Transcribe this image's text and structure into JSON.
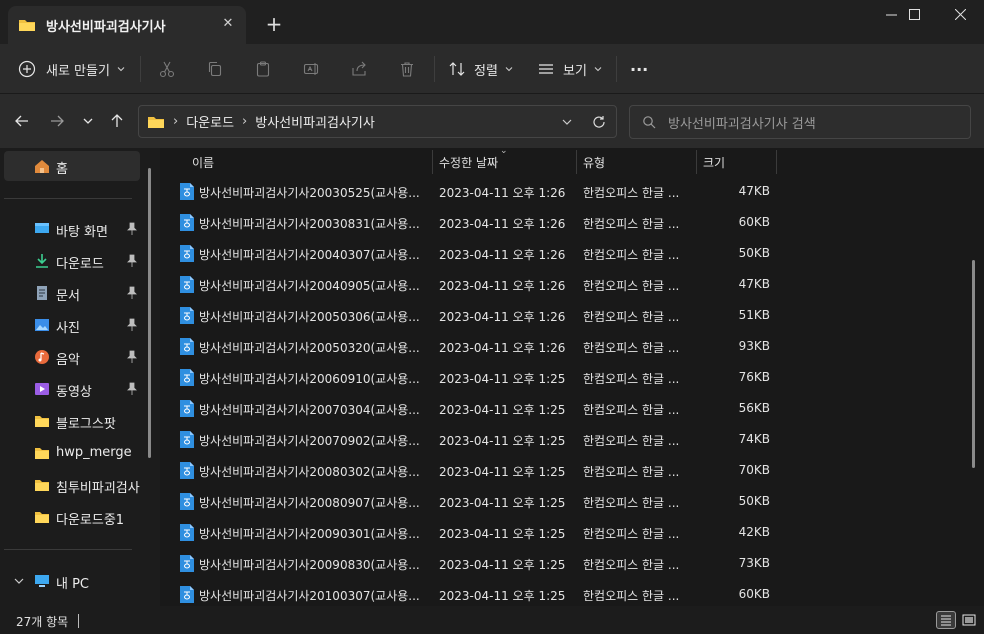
{
  "window": {
    "tab_title": "방사선비파괴검사기사",
    "new_tab_symbol": "+",
    "close_tab_symbol": "✕",
    "minimize_symbol": "—",
    "maximize_symbol": "☐",
    "close_symbol": "✕"
  },
  "toolbar": {
    "new_label": "새로 만들기",
    "sort_label": "정렬",
    "view_label": "보기",
    "more_symbol": "···"
  },
  "address": {
    "segments": [
      "다운로드",
      "방사선비파괴검사기사"
    ],
    "search_placeholder": "방사선비파괴검사기사 검색"
  },
  "sidebar": {
    "home": "홈",
    "quick_access": [
      {
        "label": "바탕 화면",
        "icon": "desktop-icon",
        "pinned": true
      },
      {
        "label": "다운로드",
        "icon": "download-icon",
        "pinned": true
      },
      {
        "label": "문서",
        "icon": "document-icon",
        "pinned": true
      },
      {
        "label": "사진",
        "icon": "picture-icon",
        "pinned": true
      },
      {
        "label": "음악",
        "icon": "music-icon",
        "pinned": true
      },
      {
        "label": "동영상",
        "icon": "video-icon",
        "pinned": true
      },
      {
        "label": "블로그스팟",
        "icon": "folder-icon",
        "pinned": false
      },
      {
        "label": "hwp_merge",
        "icon": "folder-icon",
        "pinned": false
      },
      {
        "label": "침투비파괴검사",
        "icon": "folder-icon",
        "pinned": false
      },
      {
        "label": "다운로드중1",
        "icon": "folder-icon",
        "pinned": false
      }
    ],
    "this_pc": "내 PC"
  },
  "columns": {
    "name": "이름",
    "date": "수정한 날짜",
    "type": "유형",
    "size": "크기"
  },
  "files": [
    {
      "name": "방사선비파괴검사기사20030525(교사용...",
      "date": "2023-04-11 오후 1:26",
      "type": "한컴오피스 한글 ...",
      "size": "47KB"
    },
    {
      "name": "방사선비파괴검사기사20030831(교사용...",
      "date": "2023-04-11 오후 1:26",
      "type": "한컴오피스 한글 ...",
      "size": "60KB"
    },
    {
      "name": "방사선비파괴검사기사20040307(교사용...",
      "date": "2023-04-11 오후 1:26",
      "type": "한컴오피스 한글 ...",
      "size": "50KB"
    },
    {
      "name": "방사선비파괴검사기사20040905(교사용...",
      "date": "2023-04-11 오후 1:26",
      "type": "한컴오피스 한글 ...",
      "size": "47KB"
    },
    {
      "name": "방사선비파괴검사기사20050306(교사용...",
      "date": "2023-04-11 오후 1:26",
      "type": "한컴오피스 한글 ...",
      "size": "51KB"
    },
    {
      "name": "방사선비파괴검사기사20050320(교사용...",
      "date": "2023-04-11 오후 1:26",
      "type": "한컴오피스 한글 ...",
      "size": "93KB"
    },
    {
      "name": "방사선비파괴검사기사20060910(교사용...",
      "date": "2023-04-11 오후 1:25",
      "type": "한컴오피스 한글 ...",
      "size": "76KB"
    },
    {
      "name": "방사선비파괴검사기사20070304(교사용...",
      "date": "2023-04-11 오후 1:25",
      "type": "한컴오피스 한글 ...",
      "size": "56KB"
    },
    {
      "name": "방사선비파괴검사기사20070902(교사용...",
      "date": "2023-04-11 오후 1:25",
      "type": "한컴오피스 한글 ...",
      "size": "74KB"
    },
    {
      "name": "방사선비파괴검사기사20080302(교사용...",
      "date": "2023-04-11 오후 1:25",
      "type": "한컴오피스 한글 ...",
      "size": "70KB"
    },
    {
      "name": "방사선비파괴검사기사20080907(교사용...",
      "date": "2023-04-11 오후 1:25",
      "type": "한컴오피스 한글 ...",
      "size": "50KB"
    },
    {
      "name": "방사선비파괴검사기사20090301(교사용...",
      "date": "2023-04-11 오후 1:25",
      "type": "한컴오피스 한글 ...",
      "size": "42KB"
    },
    {
      "name": "방사선비파괴검사기사20090830(교사용...",
      "date": "2023-04-11 오후 1:25",
      "type": "한컴오피스 한글 ...",
      "size": "73KB"
    },
    {
      "name": "방사선비파괴검사기사20100307(교사용...",
      "date": "2023-04-11 오후 1:25",
      "type": "한컴오피스 한글 ...",
      "size": "60KB"
    }
  ],
  "status": {
    "item_count": "27개 항목"
  },
  "colors": {
    "folder": "#f0c040",
    "hwp_icon": "#2f8fe0",
    "accent": "#4cc2ff"
  }
}
